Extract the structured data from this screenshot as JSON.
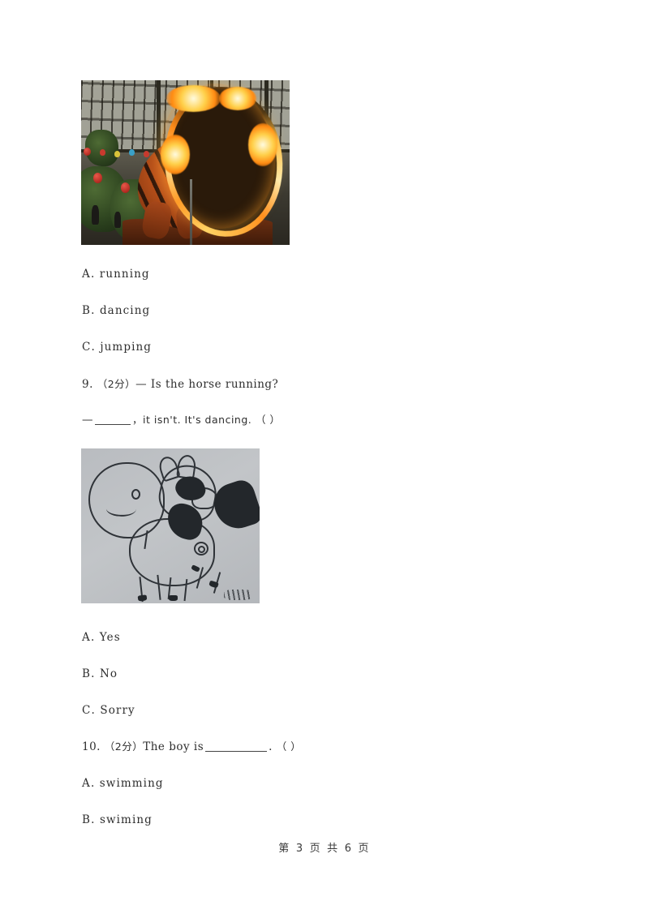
{
  "document": {
    "type": "exam-paper",
    "page_background": "#ffffff",
    "footer": "第 3 页 共 6 页"
  },
  "questions": [
    {
      "id": "q8-options",
      "figure": {
        "name": "tiger-jumping-through-ring-of-fire-photo",
        "alt": "Photograph of a tiger leaping through a flaming hoop at a show",
        "colors": {
          "tiger": "#d4681f",
          "flame": "#ffd04a",
          "background": "#2a2720"
        }
      },
      "options": [
        {
          "letter": "A",
          "separator": ".",
          "text": "running"
        },
        {
          "letter": "B",
          "separator": ".",
          "text": "dancing"
        },
        {
          "letter": "C",
          "separator": ".",
          "text": "jumping"
        }
      ]
    },
    {
      "id": "q9",
      "number": "9.",
      "score": "（2分）",
      "prompt_line1": "— Is the horse running?",
      "prompt_line2_before": "—",
      "prompt_line2_after": "，it isn't. It's dancing.",
      "answer_brackets": "（    ）",
      "figure": {
        "name": "horse-pencil-drawing",
        "alt": "Pencil sketch of a cartoon horse with a balloon on gray paper",
        "colors": {
          "paper": "#bcbfc3",
          "ink": "#2f3338"
        }
      },
      "options": [
        {
          "letter": "A",
          "separator": ".",
          "text": "Yes"
        },
        {
          "letter": "B",
          "separator": ".",
          "text": "No"
        },
        {
          "letter": "C",
          "separator": ".",
          "text": "Sorry"
        }
      ]
    },
    {
      "id": "q10",
      "number": "10.",
      "score": "（2分）",
      "prompt_before": "The boy is",
      "prompt_after": ".",
      "answer_brackets": "（    ）",
      "options": [
        {
          "letter": "A",
          "separator": ".",
          "text": "swimming"
        },
        {
          "letter": "B",
          "separator": ".",
          "text": "swiming"
        }
      ]
    }
  ]
}
